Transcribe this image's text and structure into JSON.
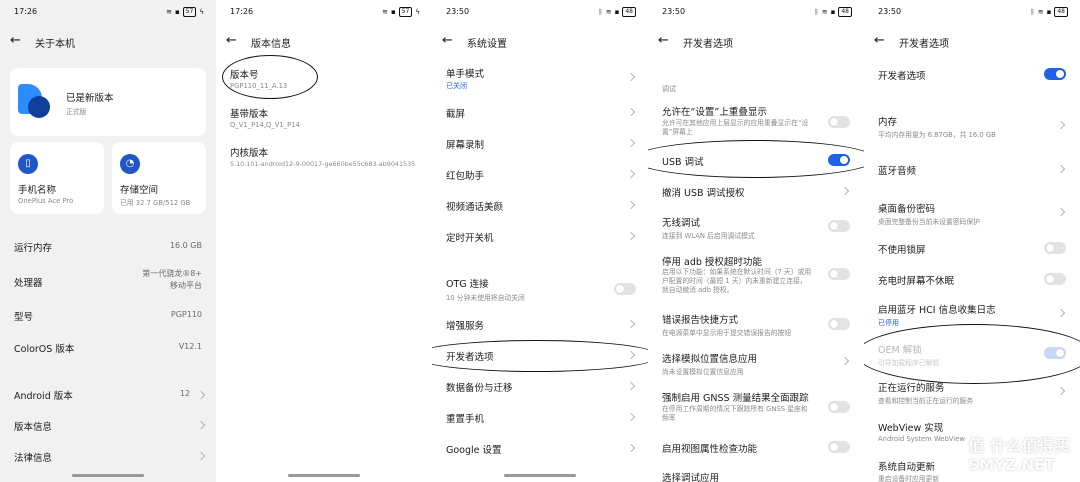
{
  "panels": [
    {
      "time": "17:26",
      "battery": "57",
      "title": "关于本机",
      "version_card": {
        "status": "已是新版本",
        "type": "正式版"
      },
      "device_name": {
        "label": "手机名称",
        "value": "OnePlus Ace Pro"
      },
      "storage": {
        "label": "存储空间",
        "value": "已用 32.7 GB/512 GB"
      },
      "rows": [
        {
          "label": "运行内存",
          "value": "16.0 GB"
        },
        {
          "label": "处理器",
          "value": "第一代骁龙®8+ 移动平台"
        },
        {
          "label": "型号",
          "value": "PGP110"
        },
        {
          "label": "ColorOS 版本",
          "value": "V12.1"
        },
        {
          "label": "Android 版本",
          "value": "12"
        },
        {
          "label": "版本信息",
          "value": ""
        },
        {
          "label": "法律信息",
          "value": ""
        }
      ]
    },
    {
      "time": "17:26",
      "battery": "57",
      "title": "版本信息",
      "rows": [
        {
          "label": "版本号",
          "value": "PGP110_11_A.13"
        },
        {
          "label": "基带版本",
          "value": "Q_V1_P14,Q_V1_P14"
        },
        {
          "label": "内核版本",
          "value": "5.10.101-android12-9-00017-ge660be55c683-ab9041535"
        }
      ]
    },
    {
      "time": "23:50",
      "battery": "48",
      "title": "系统设置",
      "rows": [
        {
          "label": "单手模式",
          "sub": "已关闭"
        },
        {
          "label": "截屏"
        },
        {
          "label": "屏幕录制"
        },
        {
          "label": "红包助手"
        },
        {
          "label": "视频通话美颜"
        },
        {
          "label": "定时开关机"
        },
        {
          "label": "OTG 连接",
          "sub": "10 分钟未使用将自动关闭"
        },
        {
          "label": "增强服务"
        },
        {
          "label": "开发者选项"
        },
        {
          "label": "数据备份与迁移"
        },
        {
          "label": "重置手机"
        },
        {
          "label": "Google 设置"
        }
      ]
    },
    {
      "time": "23:50",
      "battery": "48",
      "title": "开发者选项",
      "section": "调试",
      "rows": [
        {
          "label": "允许在“设置”上重叠显示",
          "sub": "允许可在其他应用上层显示的应用重叠显示在“设置”屏幕上"
        },
        {
          "label": "USB 调试"
        },
        {
          "label": "撤消 USB 调试授权"
        },
        {
          "label": "无线调试",
          "sub": "连接到 WLAN 后启用调试模式"
        },
        {
          "label": "停用 adb 授权超时功能",
          "sub": "启用以下功能：如果系统在默认时间（7 天）或用户配置的时间（最短 1 天）内未重新建立连接，就自动撤消 adb 授权。"
        },
        {
          "label": "错误报告快捷方式",
          "sub": "在电源菜单中显示用于提交错误报告的按钮"
        },
        {
          "label": "选择模拟位置信息应用",
          "sub": "尚未设置模拟位置信息应用"
        },
        {
          "label": "强制启用 GNSS 测量结果全面跟踪",
          "sub": "在停用工作周期的情况下跟踪所有 GNSS 星座和频率"
        },
        {
          "label": "启用视图属性检查功能"
        },
        {
          "label": "选择调试应用"
        }
      ]
    },
    {
      "time": "23:50",
      "battery": "48",
      "title": "开发者选项",
      "master": "开发者选项",
      "rows": [
        {
          "label": "内存",
          "sub": "平均内存用量为 6.87GB，共 16.0 GB"
        },
        {
          "label": "蓝牙音频"
        },
        {
          "label": "桌面备份密码",
          "sub": "桌面完整备份当前未设置密码保护"
        },
        {
          "label": "不使用锁屏"
        },
        {
          "label": "充电时屏幕不休眠"
        },
        {
          "label": "启用蓝牙 HCI 信息收集日志",
          "sub": "已停用"
        },
        {
          "label": "OEM 解锁",
          "sub": "引导加载程序已解锁"
        },
        {
          "label": "正在运行的服务",
          "sub": "查看和控制当前正在运行的服务"
        },
        {
          "label": "WebView 实现",
          "sub": "Android System WebView"
        },
        {
          "label": "系统自动更新",
          "sub": "重启设备时应用更新"
        }
      ]
    }
  ],
  "watermark": "值 什么值得买",
  "watermark_url": "SMYZ.NET",
  "colors": {
    "accent": "#1f62e5",
    "background": "#f3f3f3",
    "card": "#ffffff"
  }
}
